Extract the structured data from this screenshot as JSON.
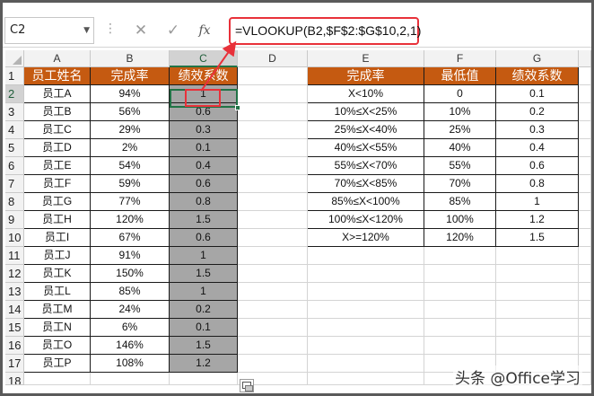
{
  "formula_bar": {
    "name_box": "C2",
    "cancel_glyph": "✕",
    "enter_glyph": "✓",
    "fx_glyph": "fx",
    "formula": "=VLOOKUP(B2,$F$2:$G$10,2,1)"
  },
  "columns": [
    "A",
    "B",
    "C",
    "D",
    "E",
    "F",
    "G"
  ],
  "rows": [
    "1",
    "2",
    "3",
    "4",
    "5",
    "6",
    "7",
    "8",
    "9",
    "10",
    "11",
    "12",
    "13",
    "14",
    "15",
    "16",
    "17",
    "18"
  ],
  "selected_cell": "C2",
  "employee_table": {
    "headers": [
      "员工姓名",
      "完成率",
      "绩效系数"
    ],
    "rows": [
      [
        "员工A",
        "94%",
        "1"
      ],
      [
        "员工B",
        "56%",
        "0.6"
      ],
      [
        "员工C",
        "29%",
        "0.3"
      ],
      [
        "员工D",
        "2%",
        "0.1"
      ],
      [
        "员工E",
        "54%",
        "0.4"
      ],
      [
        "员工F",
        "59%",
        "0.6"
      ],
      [
        "员工G",
        "77%",
        "0.8"
      ],
      [
        "员工H",
        "120%",
        "1.5"
      ],
      [
        "员工I",
        "67%",
        "0.6"
      ],
      [
        "员工J",
        "91%",
        "1"
      ],
      [
        "员工K",
        "150%",
        "1.5"
      ],
      [
        "员工L",
        "85%",
        "1"
      ],
      [
        "员工M",
        "24%",
        "0.2"
      ],
      [
        "员工N",
        "6%",
        "0.1"
      ],
      [
        "员工O",
        "146%",
        "1.5"
      ],
      [
        "员工P",
        "108%",
        "1.2"
      ]
    ]
  },
  "lookup_table": {
    "headers": [
      "完成率",
      "最低值",
      "绩效系数"
    ],
    "rows": [
      [
        "X<10%",
        "0",
        "0.1"
      ],
      [
        "10%≤X<25%",
        "10%",
        "0.2"
      ],
      [
        "25%≤X<40%",
        "25%",
        "0.3"
      ],
      [
        "40%≤X<55%",
        "40%",
        "0.4"
      ],
      [
        "55%≤X<70%",
        "55%",
        "0.6"
      ],
      [
        "70%≤X<85%",
        "70%",
        "0.8"
      ],
      [
        "85%≤X<100%",
        "85%",
        "1"
      ],
      [
        "100%≤X<120%",
        "100%",
        "1.2"
      ],
      [
        "X>=120%",
        "120%",
        "1.5"
      ]
    ]
  },
  "watermark": "头条 @Office学习",
  "colors": {
    "header_fill": "#c55a11",
    "header_text": "#ffffff",
    "result_fill": "#a6a6a6",
    "highlight": "#e8313a",
    "selection": "#217346"
  }
}
